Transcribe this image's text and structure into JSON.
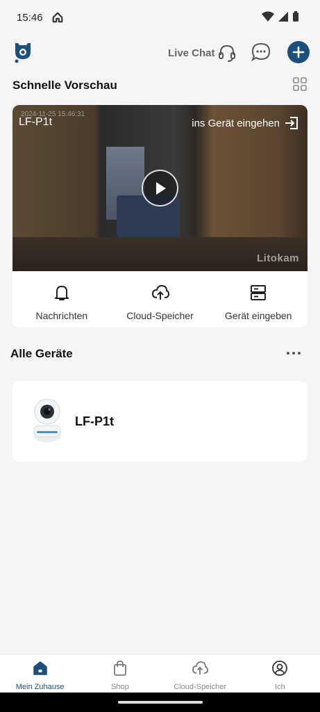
{
  "status_bar": {
    "time": "15:46"
  },
  "header": {
    "live_chat": "Live Chat"
  },
  "quick_preview": {
    "title": "Schnelle Vorschau",
    "camera_name": "LF-P1t",
    "timestamp": "2024-11-25 15:46:31",
    "enter_device": "ins Gerät eingehen",
    "watermark": "Litokam",
    "actions": [
      {
        "label": "Nachrichten",
        "icon": "bell-icon"
      },
      {
        "label": "Cloud-Speicher",
        "icon": "cloud-upload-icon"
      },
      {
        "label": "Gerät eingeben",
        "icon": "server-icon"
      }
    ]
  },
  "devices": {
    "title": "Alle Geräte",
    "items": [
      {
        "name": "LF-P1t"
      }
    ]
  },
  "bottom_nav": {
    "items": [
      {
        "label": "Mein Zuhause",
        "icon": "home-icon",
        "active": true
      },
      {
        "label": "Shop",
        "icon": "shopping-bag-icon",
        "active": false
      },
      {
        "label": "Cloud-Speicher",
        "icon": "cloud-upload-icon",
        "active": false
      },
      {
        "label": "Ich",
        "icon": "user-circle-icon",
        "active": false
      }
    ]
  },
  "colors": {
    "accent": "#1c4f7c",
    "background": "#f5f5f7"
  }
}
